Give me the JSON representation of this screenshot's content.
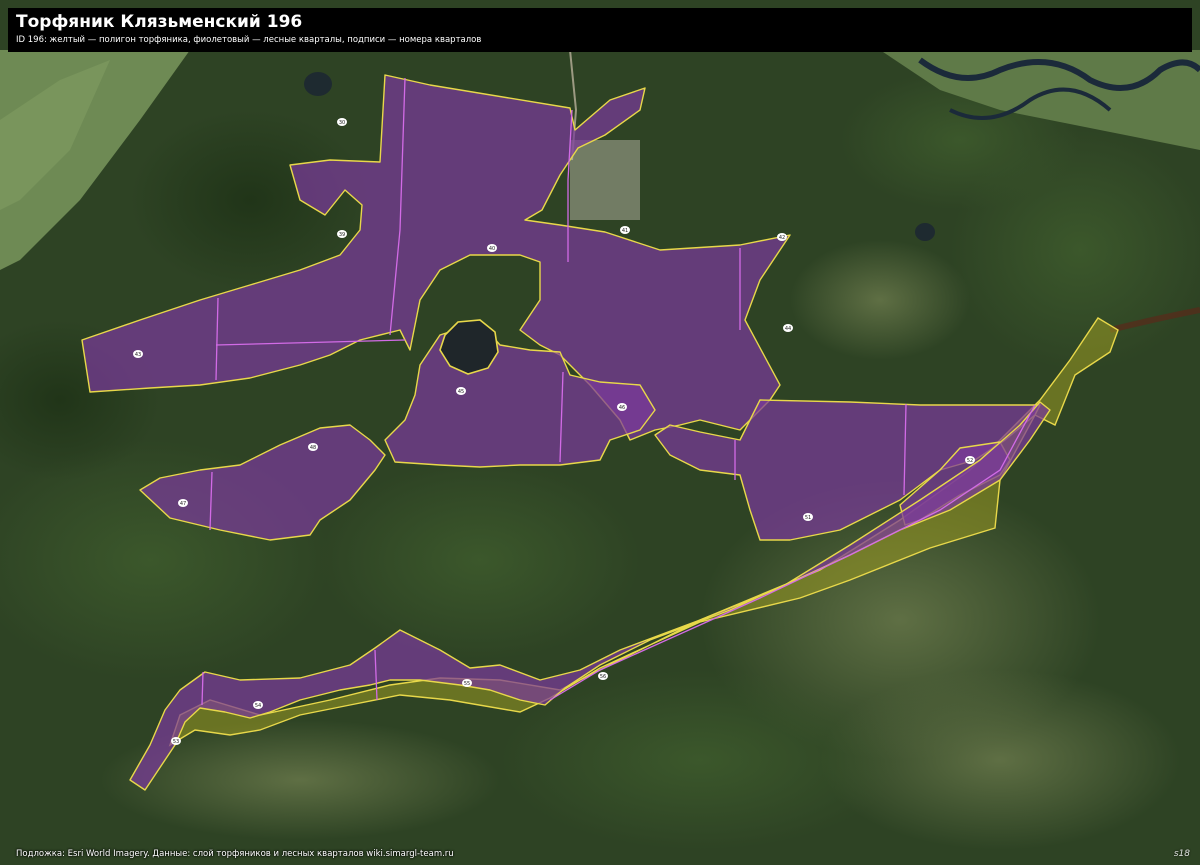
{
  "header": {
    "title": "Торфяник Клязьменский 196",
    "subtitle": "ID 196: желтый — полигон торфяника, фиолетовый — лесные кварталы, подписи — номера кварталов"
  },
  "footer": {
    "attribution": "Подложка: Esri World Imagery. Данные: слой торфяников и лесных кварталов wiki.simargl-team.ru",
    "watermark": "s18"
  },
  "legend": {
    "peat_color": "#e8d84a",
    "quarter_color": "#d26be6",
    "fill_color": "#7a3a9a"
  },
  "quarters": [
    {
      "id": "q30",
      "label": "30"
    },
    {
      "id": "q39",
      "label": "39"
    },
    {
      "id": "q40",
      "label": "40"
    },
    {
      "id": "q41",
      "label": "41"
    },
    {
      "id": "q42",
      "label": "42"
    },
    {
      "id": "q43",
      "label": "43"
    },
    {
      "id": "q44",
      "label": "44"
    },
    {
      "id": "q45",
      "label": "45"
    },
    {
      "id": "q46",
      "label": "46"
    },
    {
      "id": "q47",
      "label": "47"
    },
    {
      "id": "q48",
      "label": "48"
    },
    {
      "id": "q51",
      "label": "51"
    },
    {
      "id": "q52",
      "label": "52"
    },
    {
      "id": "q53",
      "label": "53"
    },
    {
      "id": "q54",
      "label": "54"
    },
    {
      "id": "q55",
      "label": "55"
    },
    {
      "id": "q56",
      "label": "56"
    }
  ]
}
